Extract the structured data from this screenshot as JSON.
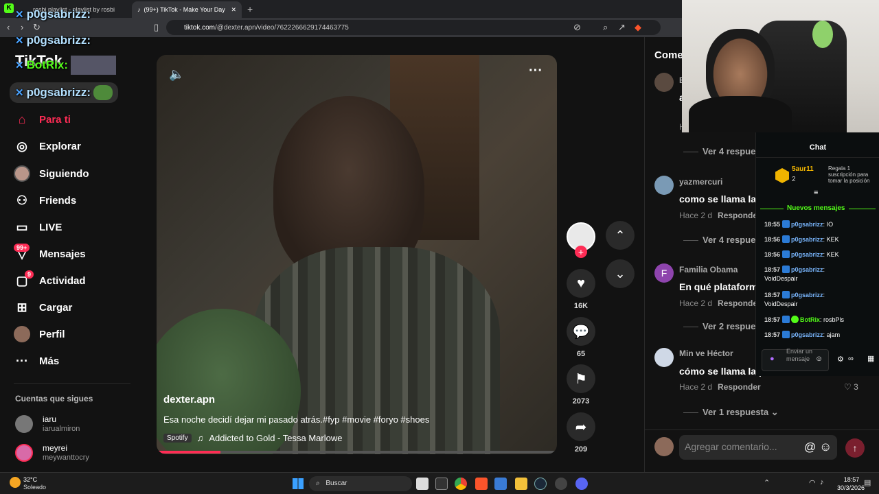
{
  "browser": {
    "tabs": [
      {
        "label": "rosbi playlist - playlist by rosbi"
      },
      {
        "label": "(99+) TikTok - Make Your Day"
      }
    ],
    "url_host": "tiktok.com",
    "url_path": "/@dexter.apn/video/7622266629174463775"
  },
  "stream_overlay": [
    {
      "user": "p0gsabrizz:"
    },
    {
      "user": "p0gsabrizz:"
    },
    {
      "user": "BotRix:"
    },
    {
      "user": "p0gsabrizz:"
    }
  ],
  "sidebar": {
    "logo": "TikTok",
    "items": [
      {
        "label": "Para ti",
        "icon": "home-icon"
      },
      {
        "label": "Explorar",
        "icon": "compass-icon"
      },
      {
        "label": "Siguiendo",
        "icon": "following-avatar"
      },
      {
        "label": "Friends",
        "icon": "friends-icon"
      },
      {
        "label": "LIVE",
        "icon": "live-icon"
      },
      {
        "label": "Mensajes",
        "icon": "messages-icon",
        "badge": "99+"
      },
      {
        "label": "Actividad",
        "icon": "activity-icon",
        "badge": "9"
      },
      {
        "label": "Cargar",
        "icon": "upload-icon"
      },
      {
        "label": "Perfil",
        "icon": "profile-avatar"
      },
      {
        "label": "Más",
        "icon": "more-icon"
      }
    ],
    "following_title": "Cuentas que sigues",
    "following": [
      {
        "name": "iaru",
        "handle": "iarualmiron"
      },
      {
        "name": "meyrei",
        "handle": "meywanttocry"
      }
    ]
  },
  "video": {
    "author": "dexter.apn",
    "caption": "Esa noche decidí dejar mi pasado atrás.#fyp #movie #foryo #shoes",
    "music_tag": "Spotify",
    "music": "Addicted to Gold - Tessa Marlowe",
    "progress": 0.16
  },
  "actions": {
    "likes": "16K",
    "comments": "65",
    "saves": "2073",
    "shares": "209"
  },
  "comments": {
    "title": "Come",
    "list": [
      {
        "user": "B",
        "text": "a",
        "meta": "H",
        "reply": "",
        "replies": "Ver 4 respues"
      },
      {
        "user": "yazmercuri",
        "text": "como se llama la p",
        "meta": "Hace 2 d",
        "reply": "Responder",
        "replies": "Ver 4 respues"
      },
      {
        "user": "Familia Obama",
        "text": "En qué plataforma",
        "meta": "Hace 2 d",
        "reply": "Responder",
        "replies": "Ver 2 respues"
      },
      {
        "user": "Min ve Héctor",
        "text": "cómo se llama la p",
        "meta": "Hace 2 d",
        "reply": "Responder",
        "replies": "Ver 1 respuesta",
        "likes": "3"
      }
    ],
    "input_placeholder": "Agregar comentario..."
  },
  "kick_chat": {
    "title": "Chat",
    "top_user": "5aur11",
    "top_rank": "2",
    "top_note": "Regala 1 suscripción para tomar la posición",
    "new_messages": "Nuevos mensajes",
    "messages": [
      {
        "time": "18:55",
        "user": "p0gsabrizz",
        "text": "IO"
      },
      {
        "time": "18:56",
        "user": "p0gsabrizz",
        "text": "KEK"
      },
      {
        "time": "18:56",
        "user": "p0gsabrizz",
        "text": "KEK"
      },
      {
        "time": "18:57",
        "user": "p0gsabrizz",
        "text": "VoidDespair"
      },
      {
        "time": "18:57",
        "user": "p0gsabrizz",
        "text": "VoidDespair"
      },
      {
        "time": "18:57",
        "user": "BotRix",
        "text": "rosbPls",
        "bot": true
      },
      {
        "time": "18:57",
        "user": "p0gsabrizz",
        "text": "ajam"
      }
    ],
    "send_placeholder": "Enviar un mensaje"
  },
  "taskbar": {
    "weather_temp": "32°C",
    "weather_desc": "Soleado",
    "search": "Buscar",
    "time": "18:57",
    "date": "30/3/2026"
  }
}
